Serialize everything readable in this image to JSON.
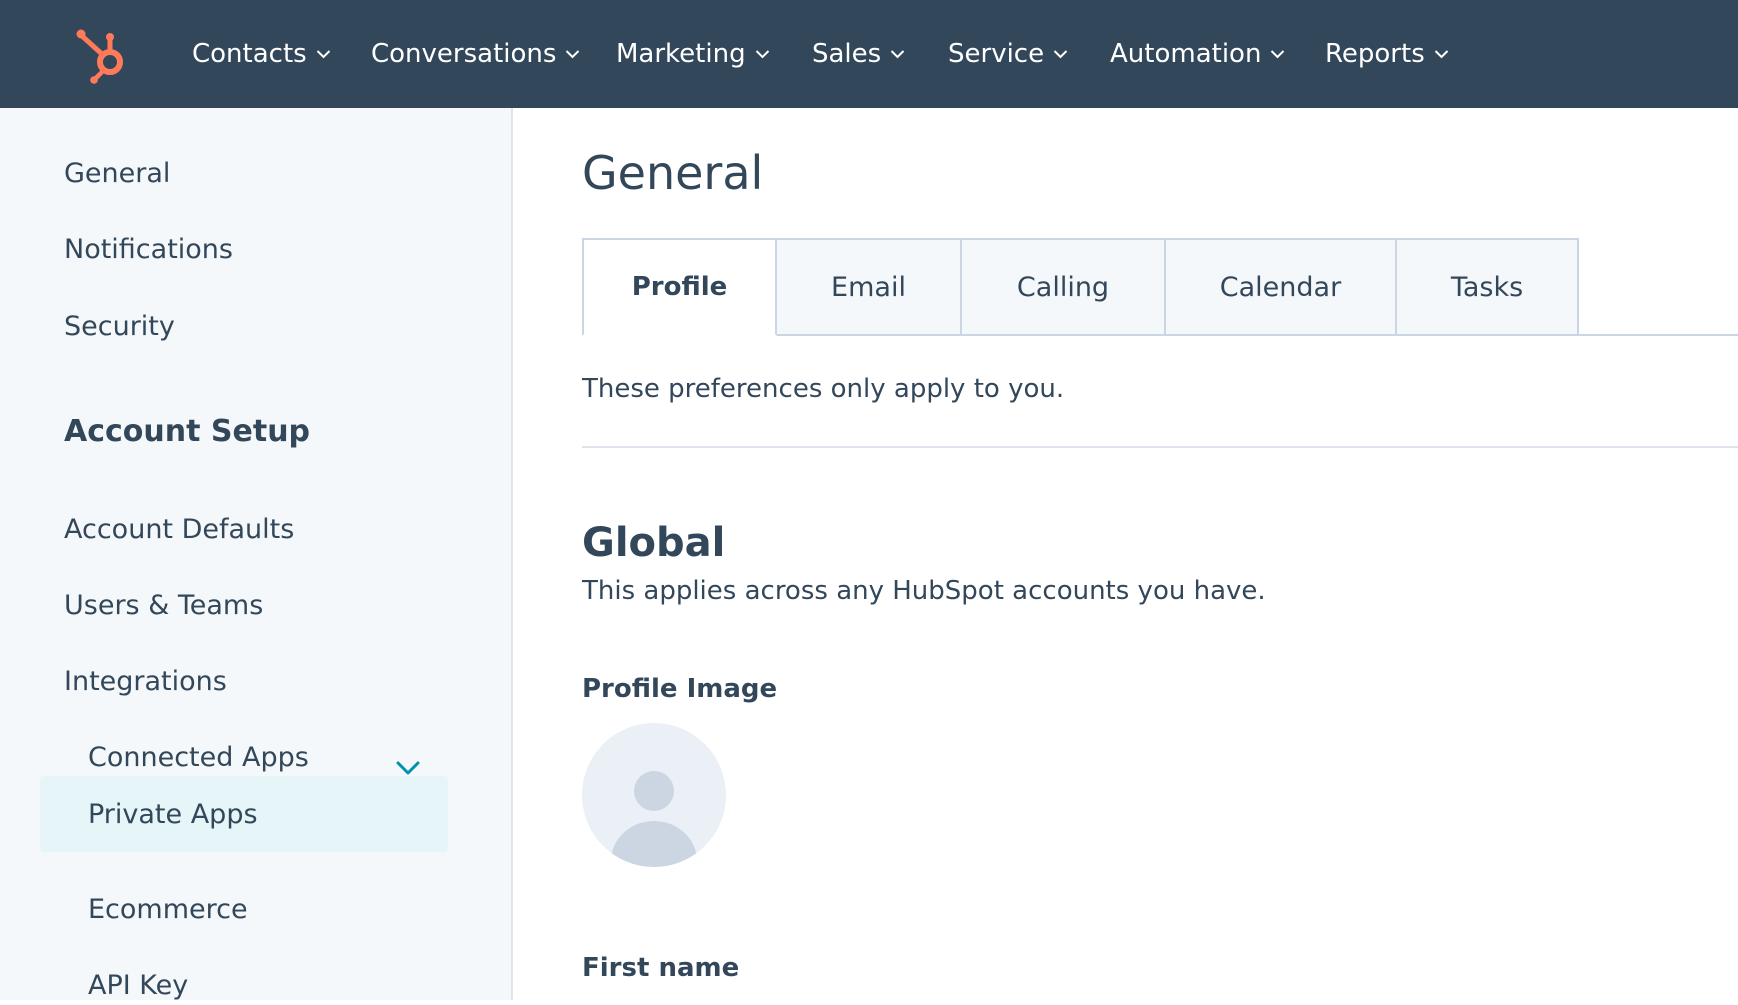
{
  "colors": {
    "nav_bg": "#33475b",
    "brand_orange": "#ff7a59",
    "text": "#33475b",
    "sidebar_bg": "#f5f8fa",
    "active_item_bg": "#e5f5f8",
    "accent_teal": "#0091ae"
  },
  "topnav": {
    "logo_icon": "hubspot-sprocket-icon",
    "items": [
      {
        "label": "Contacts"
      },
      {
        "label": "Conversations"
      },
      {
        "label": "Marketing"
      },
      {
        "label": "Sales"
      },
      {
        "label": "Service"
      },
      {
        "label": "Automation"
      },
      {
        "label": "Reports"
      }
    ]
  },
  "sidebar": {
    "items_top": [
      {
        "label": "General"
      },
      {
        "label": "Notifications"
      },
      {
        "label": "Security"
      }
    ],
    "section_heading": "Account Setup",
    "items_setup": [
      {
        "label": "Account Defaults"
      },
      {
        "label": "Users & Teams"
      },
      {
        "label": "Integrations"
      }
    ],
    "integrations_sub": [
      {
        "label": "Connected Apps"
      },
      {
        "label": "Private Apps",
        "active": true
      },
      {
        "label": "Ecommerce"
      },
      {
        "label": "API Key"
      }
    ]
  },
  "main": {
    "title": "General",
    "tabs": [
      {
        "label": "Profile",
        "active": true
      },
      {
        "label": "Email"
      },
      {
        "label": "Calling"
      },
      {
        "label": "Calendar"
      },
      {
        "label": "Tasks"
      }
    ],
    "preferences_note": "These preferences only apply to you.",
    "section": {
      "title": "Global",
      "description": "This applies across any HubSpot accounts you have."
    },
    "profile_image_label": "Profile Image",
    "first_name_label": "First name"
  }
}
